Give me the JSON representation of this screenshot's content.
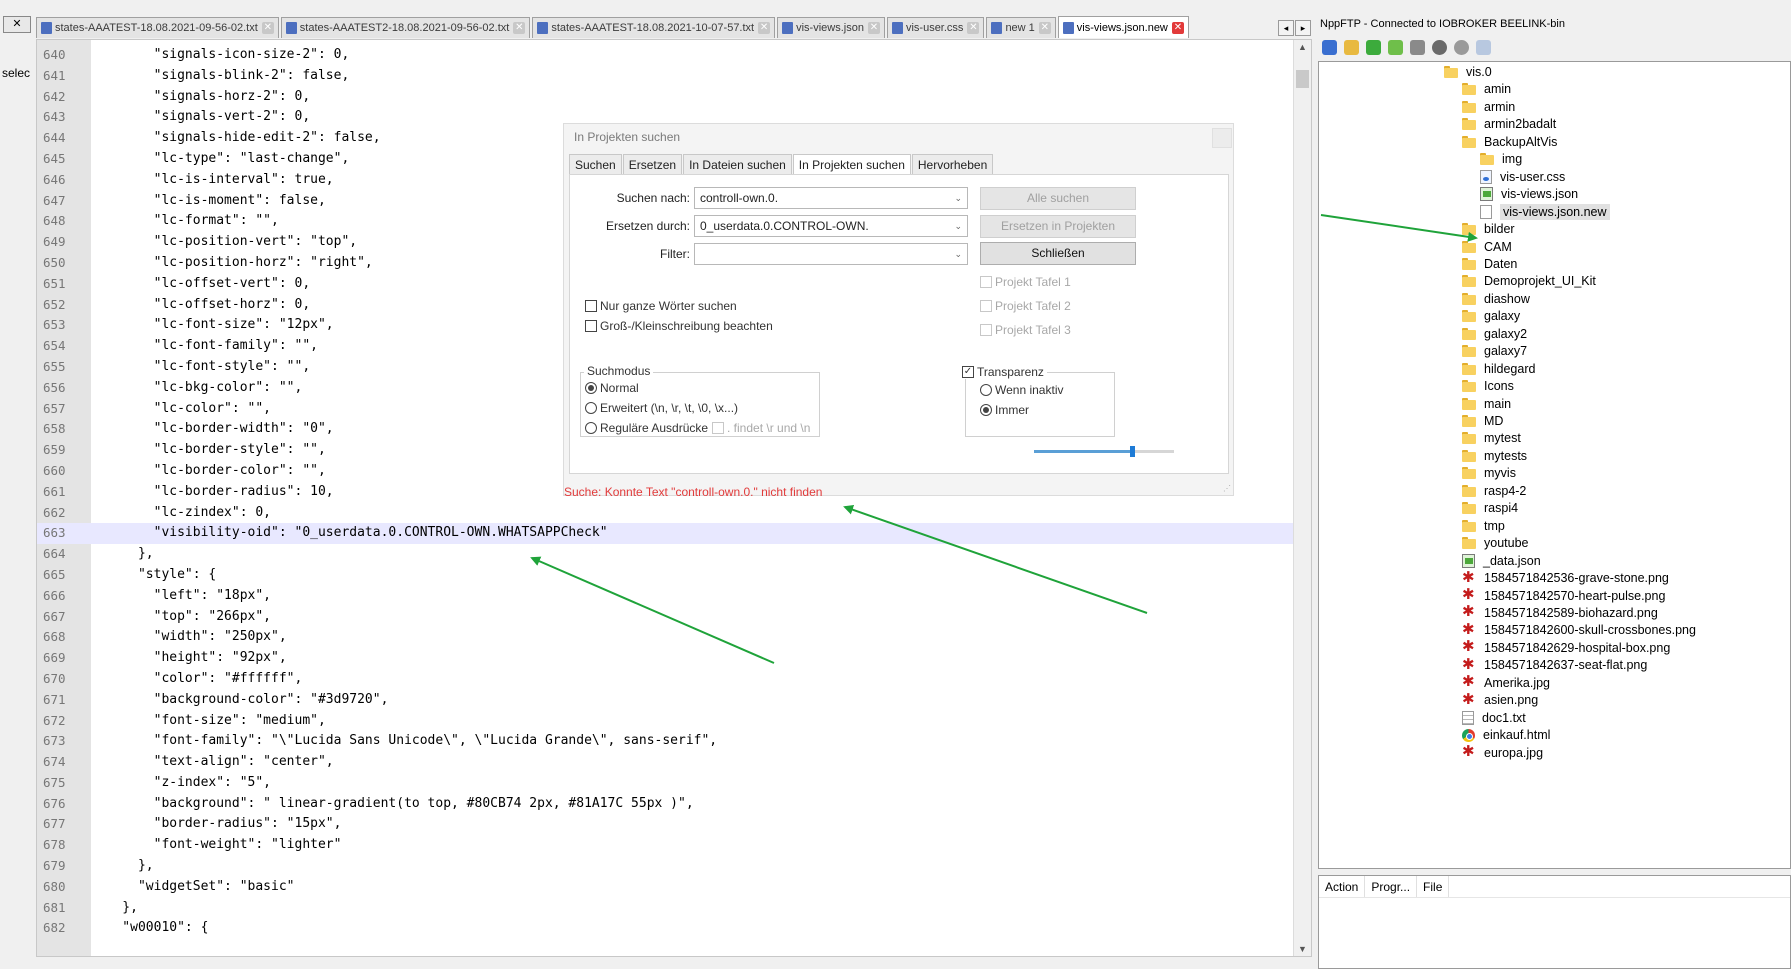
{
  "tabs": [
    {
      "label": "states-AAATEST-18.08.2021-09-56-02.txt",
      "active": false
    },
    {
      "label": "states-AAATEST2-18.08.2021-09-56-02.txt",
      "active": false
    },
    {
      "label": "states-AAATEST-18.08.2021-10-07-57.txt",
      "active": false
    },
    {
      "label": "vis-views.json",
      "active": false
    },
    {
      "label": "vis-user.css",
      "active": false
    },
    {
      "label": "new 1",
      "active": false
    },
    {
      "label": "vis-views.json.new",
      "active": true
    }
  ],
  "tab_close_symbol": "✕",
  "tab_nav": {
    "left": "◂",
    "right": "▸"
  },
  "left_strip": {
    "close_label": "✕",
    "text": "selec"
  },
  "editor": {
    "highlighted_line": 663,
    "lines": [
      {
        "n": "640",
        "t": "        \"signals-icon-size-2\": 0,"
      },
      {
        "n": "641",
        "t": "        \"signals-blink-2\": false,"
      },
      {
        "n": "642",
        "t": "        \"signals-horz-2\": 0,"
      },
      {
        "n": "643",
        "t": "        \"signals-vert-2\": 0,"
      },
      {
        "n": "644",
        "t": "        \"signals-hide-edit-2\": false,"
      },
      {
        "n": "645",
        "t": "        \"lc-type\": \"last-change\","
      },
      {
        "n": "646",
        "t": "        \"lc-is-interval\": true,"
      },
      {
        "n": "647",
        "t": "        \"lc-is-moment\": false,"
      },
      {
        "n": "648",
        "t": "        \"lc-format\": \"\","
      },
      {
        "n": "649",
        "t": "        \"lc-position-vert\": \"top\","
      },
      {
        "n": "650",
        "t": "        \"lc-position-horz\": \"right\","
      },
      {
        "n": "651",
        "t": "        \"lc-offset-vert\": 0,"
      },
      {
        "n": "652",
        "t": "        \"lc-offset-horz\": 0,"
      },
      {
        "n": "653",
        "t": "        \"lc-font-size\": \"12px\","
      },
      {
        "n": "654",
        "t": "        \"lc-font-family\": \"\","
      },
      {
        "n": "655",
        "t": "        \"lc-font-style\": \"\","
      },
      {
        "n": "656",
        "t": "        \"lc-bkg-color\": \"\","
      },
      {
        "n": "657",
        "t": "        \"lc-color\": \"\","
      },
      {
        "n": "658",
        "t": "        \"lc-border-width\": \"0\","
      },
      {
        "n": "659",
        "t": "        \"lc-border-style\": \"\","
      },
      {
        "n": "660",
        "t": "        \"lc-border-color\": \"\","
      },
      {
        "n": "661",
        "t": "        \"lc-border-radius\": 10,"
      },
      {
        "n": "662",
        "t": "        \"lc-zindex\": 0,"
      },
      {
        "n": "663",
        "t": "        \"visibility-oid\": \"0_userdata.0.CONTROL-OWN.WHATSAPPCheck\""
      },
      {
        "n": "664",
        "t": "      },"
      },
      {
        "n": "665",
        "t": "      \"style\": {"
      },
      {
        "n": "666",
        "t": "        \"left\": \"18px\","
      },
      {
        "n": "667",
        "t": "        \"top\": \"266px\","
      },
      {
        "n": "668",
        "t": "        \"width\": \"250px\","
      },
      {
        "n": "669",
        "t": "        \"height\": \"92px\","
      },
      {
        "n": "670",
        "t": "        \"color\": \"#ffffff\","
      },
      {
        "n": "671",
        "t": "        \"background-color\": \"#3d9720\","
      },
      {
        "n": "672",
        "t": "        \"font-size\": \"medium\","
      },
      {
        "n": "673",
        "t": "        \"font-family\": \"\\\"Lucida Sans Unicode\\\", \\\"Lucida Grande\\\", sans-serif\","
      },
      {
        "n": "674",
        "t": "        \"text-align\": \"center\","
      },
      {
        "n": "675",
        "t": "        \"z-index\": \"5\","
      },
      {
        "n": "676",
        "t": "        \"background\": \" linear-gradient(to top, #80CB74 2px, #81A17C 55px )\","
      },
      {
        "n": "677",
        "t": "        \"border-radius\": \"15px\","
      },
      {
        "n": "678",
        "t": "        \"font-weight\": \"lighter\""
      },
      {
        "n": "679",
        "t": "      },"
      },
      {
        "n": "680",
        "t": "      \"widgetSet\": \"basic\""
      },
      {
        "n": "681",
        "t": "    },"
      },
      {
        "n": "682",
        "t": "    \"w00010\": {"
      }
    ],
    "scroll_up": "▲",
    "scroll_down": "▼"
  },
  "dialog": {
    "title": "In Projekten suchen",
    "tabs": [
      "Suchen",
      "Ersetzen",
      "In Dateien suchen",
      "In Projekten suchen",
      "Hervorheben"
    ],
    "active_tab": 3,
    "find_label": "Suchen nach:",
    "find_value": "controll-own.0.",
    "replace_label": "Ersetzen durch:",
    "replace_value": "0_userdata.0.CONTROL-OWN.",
    "filter_label": "Filter:",
    "filter_value": "",
    "chevron": "⌄",
    "btn_find_all": "Alle suchen",
    "btn_replace": "Ersetzen in Projekten",
    "btn_close": "Schließen",
    "project_1": "Projekt Tafel 1",
    "project_2": "Projekt Tafel 2",
    "project_3": "Projekt Tafel 3",
    "whole_words": "Nur ganze Wörter suchen",
    "match_case": "Groß-/Kleinschreibung beachten",
    "search_mode_title": "Suchmodus",
    "mode_normal": "Normal",
    "mode_extended": "Erweitert (\\n, \\r, \\t, \\0, \\x...)",
    "mode_regex": "Reguläre Ausdrücke",
    "dot_newline": ". findet \\r und \\n",
    "transparency": "Transparenz",
    "when_inactive": "Wenn inaktiv",
    "always": "Immer",
    "check_mark": "✓",
    "transparency_level": 0.7,
    "status": "Suche: Konnte Text \"controll-own.0.\" nicht finden",
    "grip": "⋰"
  },
  "ftp": {
    "title": "NppFTP - Connected to  IOBROKER BEELINK-bin",
    "tree": [
      {
        "label": "vis.0",
        "icon": "folder",
        "indent": 0
      },
      {
        "label": "amin",
        "icon": "folder",
        "indent": 1
      },
      {
        "label": "armin",
        "icon": "folder",
        "indent": 1
      },
      {
        "label": "armin2badalt",
        "icon": "folder",
        "indent": 1
      },
      {
        "label": "BackupAltVis",
        "icon": "folder",
        "indent": 1
      },
      {
        "label": "img",
        "icon": "folder",
        "indent": 2
      },
      {
        "label": "vis-user.css",
        "icon": "css",
        "indent": 2
      },
      {
        "label": "vis-views.json",
        "icon": "json",
        "indent": 2
      },
      {
        "label": "vis-views.json.new",
        "icon": "file",
        "indent": 2,
        "selected": true
      },
      {
        "label": "bilder",
        "icon": "folder",
        "indent": 1
      },
      {
        "label": "CAM",
        "icon": "folder",
        "indent": 1
      },
      {
        "label": "Daten",
        "icon": "folder",
        "indent": 1
      },
      {
        "label": "Demoprojekt_UI_Kit",
        "icon": "folder",
        "indent": 1
      },
      {
        "label": "diashow",
        "icon": "folder",
        "indent": 1
      },
      {
        "label": "galaxy",
        "icon": "folder",
        "indent": 1
      },
      {
        "label": "galaxy2",
        "icon": "folder",
        "indent": 1
      },
      {
        "label": "galaxy7",
        "icon": "folder",
        "indent": 1
      },
      {
        "label": "hildegard",
        "icon": "folder",
        "indent": 1
      },
      {
        "label": "Icons",
        "icon": "folder",
        "indent": 1
      },
      {
        "label": "main",
        "icon": "folder",
        "indent": 1
      },
      {
        "label": "MD",
        "icon": "folder",
        "indent": 1
      },
      {
        "label": "mytest",
        "icon": "folder",
        "indent": 1
      },
      {
        "label": "mytests",
        "icon": "folder",
        "indent": 1
      },
      {
        "label": "myvis",
        "icon": "folder",
        "indent": 1
      },
      {
        "label": "rasp4-2",
        "icon": "folder",
        "indent": 1
      },
      {
        "label": "raspi4",
        "icon": "folder",
        "indent": 1
      },
      {
        "label": "tmp",
        "icon": "folder",
        "indent": 1
      },
      {
        "label": "youtube",
        "icon": "folder",
        "indent": 1
      },
      {
        "label": "_data.json",
        "icon": "json",
        "indent": 1
      },
      {
        "label": "1584571842536-grave-stone.png",
        "icon": "img",
        "indent": 1
      },
      {
        "label": "1584571842570-heart-pulse.png",
        "icon": "img",
        "indent": 1
      },
      {
        "label": "1584571842589-biohazard.png",
        "icon": "img",
        "indent": 1
      },
      {
        "label": "1584571842600-skull-crossbones.png",
        "icon": "img",
        "indent": 1
      },
      {
        "label": "1584571842629-hospital-box.png",
        "icon": "img",
        "indent": 1
      },
      {
        "label": "1584571842637-seat-flat.png",
        "icon": "img",
        "indent": 1
      },
      {
        "label": "Amerika.jpg",
        "icon": "img",
        "indent": 1
      },
      {
        "label": "asien.png",
        "icon": "img",
        "indent": 1
      },
      {
        "label": "doc1.txt",
        "icon": "txt",
        "indent": 1
      },
      {
        "label": "einkauf.html",
        "icon": "html",
        "indent": 1
      },
      {
        "label": "europa.jpg",
        "icon": "img",
        "indent": 1
      }
    ],
    "bottom_columns": [
      "Action",
      "Progr...",
      "File"
    ]
  },
  "colors": {
    "annotation_arrow": "#1fa33a",
    "status_error": "#e23b3b",
    "highlight_line": "#e8e8ff"
  }
}
